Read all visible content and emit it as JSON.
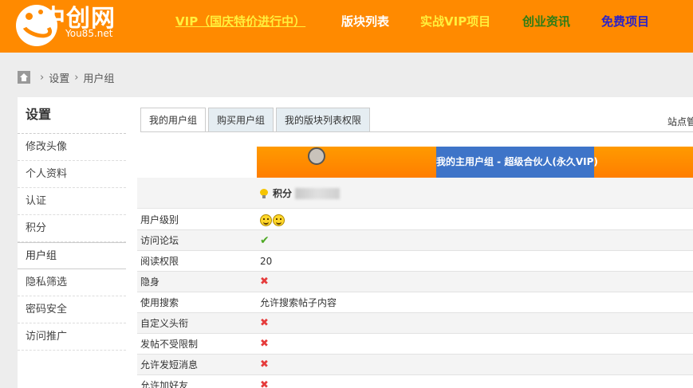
{
  "header": {
    "logo_text": "中创网",
    "logo_sub": "You85.net",
    "nav": {
      "vip": "VIP（国庆特价进行中）",
      "list": "版块列表",
      "project": "实战VIP项目",
      "news": "创业资讯",
      "free": "免费项目"
    },
    "colors": {
      "header_bg": "#ff8a00",
      "vip": "#ffef3c",
      "news": "#2e7d16",
      "free": "#2a23c9"
    }
  },
  "breadcrumb": {
    "items": [
      "设置",
      "用户组"
    ]
  },
  "sidebar": {
    "title": "设置",
    "items": [
      "修改头像",
      "个人资料",
      "认证",
      "积分",
      "用户组",
      "隐私筛选",
      "密码安全",
      "访问推广"
    ],
    "active": "用户组"
  },
  "tabs": {
    "items": [
      "我的用户组",
      "购买用户组",
      "我的版块列表权限"
    ],
    "active": "我的用户组",
    "site_manage": "站点管"
  },
  "group": {
    "title": "我的主用户组 - 超级合伙人(永久VIP)",
    "points_label": "积分"
  },
  "permissions": [
    {
      "label": "用户级别",
      "value_type": "smiles",
      "value": ""
    },
    {
      "label": "访问论坛",
      "value_type": "check",
      "value": "✔"
    },
    {
      "label": "阅读权限",
      "value_type": "text",
      "value": "20"
    },
    {
      "label": "隐身",
      "value_type": "cross",
      "value": "✖"
    },
    {
      "label": "使用搜索",
      "value_type": "text",
      "value": "允许搜索帖子内容"
    },
    {
      "label": "自定义头衔",
      "value_type": "cross",
      "value": "✖"
    },
    {
      "label": "发帖不受限制",
      "value_type": "cross",
      "value": "✖"
    },
    {
      "label": "允许发短消息",
      "value_type": "cross",
      "value": "✖"
    },
    {
      "label": "允许加好友",
      "value_type": "cross",
      "value": "✖"
    }
  ]
}
